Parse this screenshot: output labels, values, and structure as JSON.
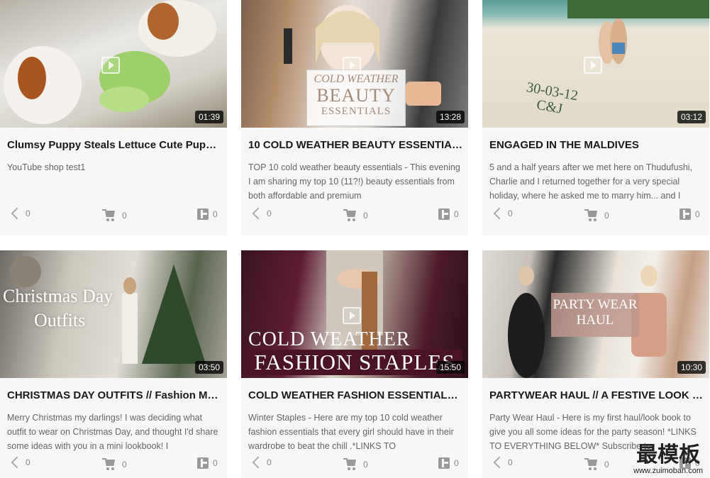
{
  "cards": [
    {
      "duration": "01:39",
      "title": "Clumsy Puppy Steals Lettuce Cute Puppy...",
      "description": "YouTube shop test1",
      "share_count": "0",
      "cart_count": "0",
      "t_count": "0"
    },
    {
      "duration": "13:28",
      "title": "10 COLD WEATHER BEAUTY ESSENTIALS...",
      "description": "TOP 10 cold weather beauty essentials - This evening I am sharing my top 10 (11?!) beauty essentials from both affordable and premium",
      "share_count": "0",
      "cart_count": "0",
      "t_count": "0",
      "overlay_lines": [
        "COLD WEATHER",
        "BEAUTY",
        "ESSENTIALS"
      ]
    },
    {
      "duration": "03:12",
      "title": "ENGAGED IN THE MALDIVES",
      "description": "5 and a half years after we met here on Thudufushi, Charlie and I returned together for a very special holiday, where he asked me to marry him... and I",
      "share_count": "0",
      "cart_count": "0",
      "t_count": "0",
      "overlay_lines": [
        "30-03-12",
        "C&J"
      ]
    },
    {
      "duration": "03:50",
      "title": "CHRISTMAS DAY OUTFITS // Fashion Mumblr...",
      "description": "Merry Christmas my darlings! I was deciding what outfit to wear on Christmas Day, and thought I'd share some ideas with you in a mini lookbook! I",
      "share_count": "0",
      "cart_count": "0",
      "t_count": "0",
      "overlay_lines": [
        "Christmas Day",
        "Outfits"
      ]
    },
    {
      "duration": "15:50",
      "title": "COLD WEATHER FASHION ESSENTIALS...",
      "description": "Winter Staples - Here are my top 10 cold weather fashion essentials that every girl should have in their wardrobe to beat the chill .*LINKS TO",
      "share_count": "0",
      "cart_count": "0",
      "t_count": "0",
      "overlay_lines": [
        "COLD WEATHER",
        "FASHION STAPLES"
      ]
    },
    {
      "duration": "10:30",
      "title": "PARTYWEAR HAUL // A FESTIVE LOOK BOOK...",
      "description": "Party Wear Haul - Here is my first haul/look book to give you all some ideas for the party season! *LINKS TO EVERYTHING BELOW* Subscribe to",
      "share_count": "0",
      "cart_count": "0",
      "t_count": "0",
      "overlay_lines": [
        "PARTY WEAR",
        "HAUL"
      ]
    }
  ],
  "icons": {
    "share": "share-icon",
    "cart": "cart-icon",
    "tumblr": "tumblr-icon",
    "play": "play-icon"
  },
  "watermark": {
    "brand": "最模板",
    "url": "www.zuimoban.com"
  }
}
